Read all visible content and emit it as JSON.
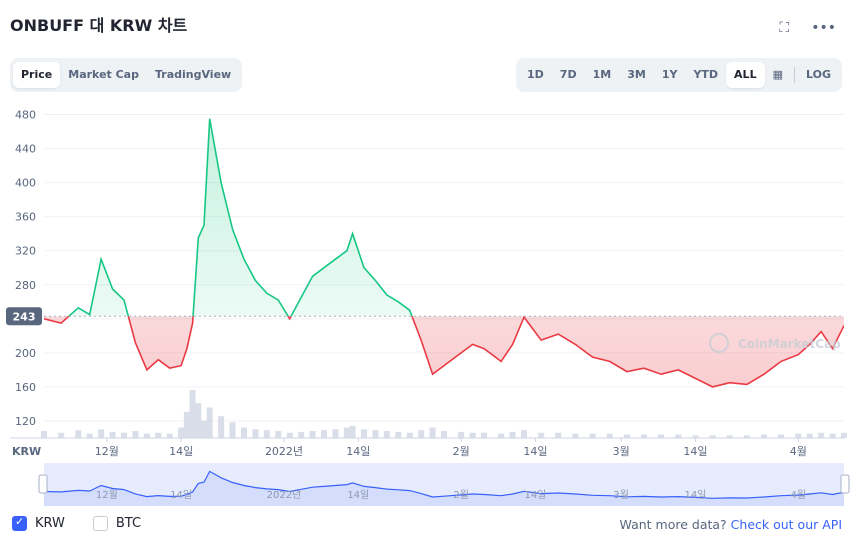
{
  "title": "ONBUFF 대 KRW 차트",
  "icons": {
    "fullscreen": "expand-icon",
    "more": "ellipsis-icon",
    "calendar": "calendar-icon"
  },
  "tabs": [
    "Price",
    "Market Cap",
    "TradingView"
  ],
  "active_tab": "Price",
  "ranges": [
    "1D",
    "7D",
    "1M",
    "3M",
    "1Y",
    "YTD",
    "ALL"
  ],
  "active_range": "ALL",
  "log_label": "LOG",
  "current_price_label": "243",
  "watermark": "CoinMarketCap",
  "axis_currency": "KRW",
  "legend": {
    "krw": "KRW",
    "btc": "BTC",
    "krw_checked": true,
    "btc_checked": false
  },
  "footer": {
    "prefix": "Want more data?",
    "link": "Check out our API"
  },
  "colors": {
    "up": "#16c784",
    "down": "#ea3943",
    "nav": "#3861fb",
    "baseline": "#58667e"
  },
  "chart_data": {
    "type": "line",
    "currency": "KRW",
    "ylim": [
      100,
      490
    ],
    "yticks": [
      120,
      160,
      200,
      240,
      280,
      320,
      360,
      400,
      440,
      480
    ],
    "ytick_labels": [
      "120",
      "160",
      "200",
      "",
      "280",
      "320",
      "360",
      "400",
      "440",
      "480"
    ],
    "baseline": 243,
    "xticks": [
      {
        "date": "2021-12-01",
        "label": "12월"
      },
      {
        "date": "2021-12-14",
        "label": "14일"
      },
      {
        "date": "2022-01-01",
        "label": "2022년"
      },
      {
        "date": "2022-01-14",
        "label": "14일"
      },
      {
        "date": "2022-02-01",
        "label": "2월"
      },
      {
        "date": "2022-02-14",
        "label": "14일"
      },
      {
        "date": "2022-03-01",
        "label": "3월"
      },
      {
        "date": "2022-03-14",
        "label": "14일"
      },
      {
        "date": "2022-04-01",
        "label": "4월"
      }
    ],
    "x": [
      "2021-11-20",
      "2021-11-23",
      "2021-11-26",
      "2021-11-28",
      "2021-11-30",
      "2021-12-02",
      "2021-12-04",
      "2021-12-06",
      "2021-12-08",
      "2021-12-10",
      "2021-12-12",
      "2021-12-14",
      "2021-12-15",
      "2021-12-16",
      "2021-12-17",
      "2021-12-18",
      "2021-12-19",
      "2021-12-21",
      "2021-12-23",
      "2021-12-25",
      "2021-12-27",
      "2021-12-29",
      "2021-12-31",
      "2022-01-02",
      "2022-01-04",
      "2022-01-06",
      "2022-01-08",
      "2022-01-10",
      "2022-01-12",
      "2022-01-13",
      "2022-01-15",
      "2022-01-17",
      "2022-01-19",
      "2022-01-21",
      "2022-01-23",
      "2022-01-25",
      "2022-01-27",
      "2022-01-29",
      "2022-02-01",
      "2022-02-03",
      "2022-02-05",
      "2022-02-08",
      "2022-02-10",
      "2022-02-12",
      "2022-02-15",
      "2022-02-18",
      "2022-02-21",
      "2022-02-24",
      "2022-02-27",
      "2022-03-02",
      "2022-03-05",
      "2022-03-08",
      "2022-03-11",
      "2022-03-14",
      "2022-03-17",
      "2022-03-20",
      "2022-03-23",
      "2022-03-26",
      "2022-03-29",
      "2022-04-01",
      "2022-04-03",
      "2022-04-05",
      "2022-04-07",
      "2022-04-09"
    ],
    "y": [
      240,
      235,
      253,
      245,
      310,
      275,
      262,
      212,
      180,
      192,
      182,
      185,
      205,
      235,
      335,
      350,
      475,
      400,
      345,
      310,
      285,
      270,
      262,
      240,
      265,
      290,
      300,
      310,
      320,
      340,
      300,
      285,
      268,
      260,
      250,
      215,
      175,
      185,
      200,
      210,
      205,
      190,
      210,
      242,
      215,
      222,
      210,
      195,
      190,
      178,
      182,
      175,
      180,
      170,
      160,
      165,
      163,
      175,
      190,
      198,
      210,
      225,
      205,
      232
    ],
    "volume_note": "volume bars shown",
    "volume": [
      8,
      6,
      9,
      5,
      10,
      7,
      6,
      8,
      5,
      6,
      5,
      12,
      30,
      55,
      40,
      20,
      35,
      25,
      18,
      12,
      10,
      9,
      8,
      6,
      7,
      8,
      9,
      10,
      12,
      14,
      10,
      9,
      8,
      7,
      6,
      9,
      12,
      8,
      7,
      6,
      6,
      5,
      7,
      9,
      6,
      6,
      5,
      5,
      5,
      4,
      4,
      4,
      4,
      3,
      3,
      3,
      3,
      4,
      4,
      5,
      5,
      6,
      5,
      6
    ]
  }
}
